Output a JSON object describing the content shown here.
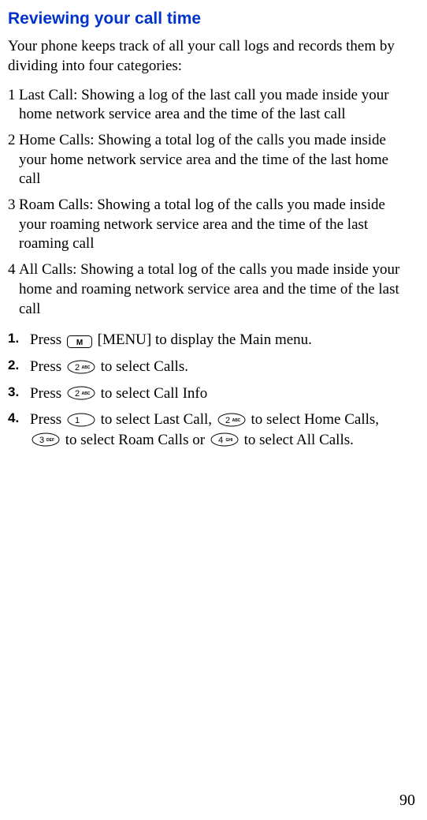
{
  "title": "Reviewing your call time",
  "intro": "Your phone keeps track of all your call logs and records them by dividing into four categories:",
  "categories": [
    {
      "num": "1",
      "text": "Last Call: Showing a log of the last call you made inside your home network service area and the time of the last call"
    },
    {
      "num": "2",
      "text": "Home Calls: Showing a total log of the calls you made inside your home network service area and the time of the last home call"
    },
    {
      "num": "3",
      "text": "Roam Calls: Showing a total log of the calls you made inside your roaming network service area and the time of the last roaming call"
    },
    {
      "num": "4",
      "text": "All Calls: Showing a total log of the calls you made inside your home and roaming network service area and the time of the last call"
    }
  ],
  "steps": [
    {
      "num": "1.",
      "pre": "Press ",
      "post": " [MENU] to display the Main menu."
    },
    {
      "num": "2.",
      "pre": "Press ",
      "post": " to select Calls."
    },
    {
      "num": "3.",
      "pre": "Press ",
      "post": " to select Call Info"
    },
    {
      "num": "4.",
      "pre": "Press ",
      "mid1": " to select Last Call, ",
      "mid2": " to select Home Calls, ",
      "mid3": "  to select Roam Calls or ",
      "post": " to select All Calls."
    }
  ],
  "keys": {
    "m": "M",
    "one": "1",
    "two": {
      "digit": "2",
      "label": "ABC"
    },
    "three": {
      "digit": "3",
      "label": "DEF"
    },
    "four": {
      "digit": "4",
      "label": "GHI"
    }
  },
  "page": "90"
}
